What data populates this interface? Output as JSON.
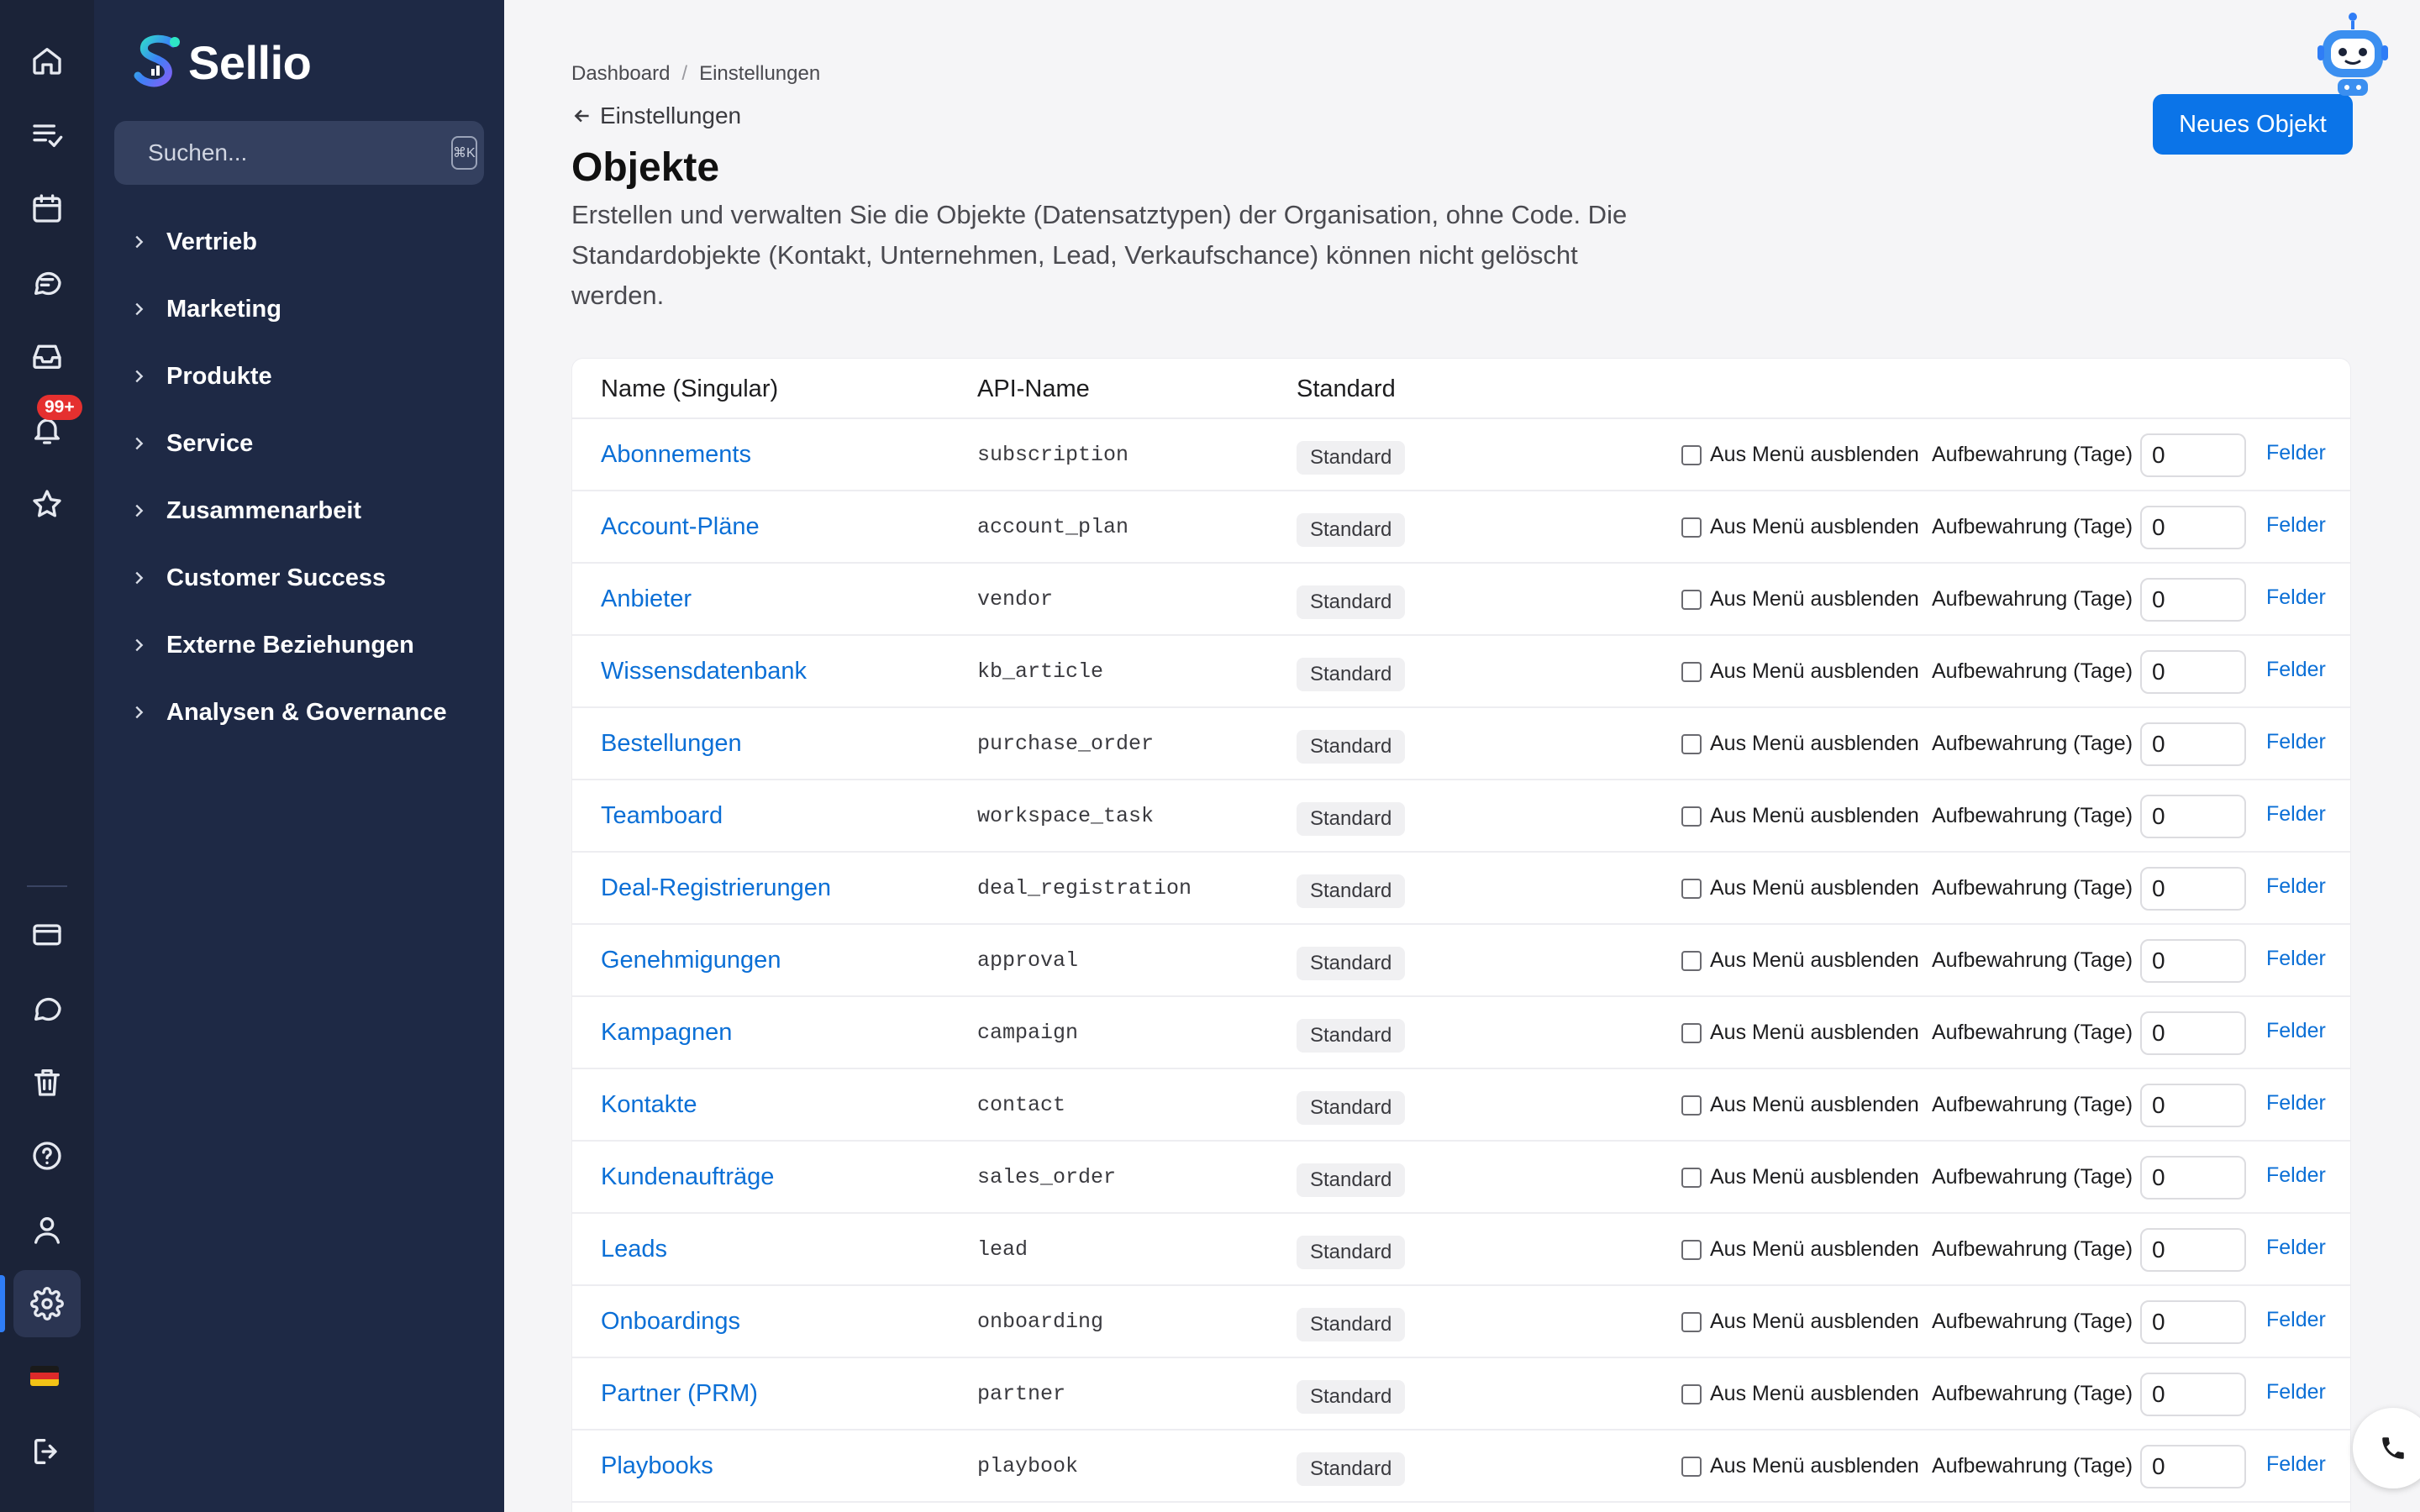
{
  "app": {
    "name": "Sellio"
  },
  "rail": {
    "items": [
      "home-icon",
      "tasks-icon",
      "calendar-icon",
      "chat-icon",
      "inbox-icon",
      "bell-icon",
      "star-icon",
      "card-icon",
      "comment-icon",
      "trash-icon",
      "help-icon",
      "user-icon",
      "gear-icon",
      "flag-de-icon",
      "logout-icon"
    ],
    "notification_badge": "99+",
    "active_color": "#2f7df6"
  },
  "sidebar": {
    "search_placeholder": "Suchen...",
    "search_shortcut": "⌘K",
    "items": [
      {
        "label": "Vertrieb"
      },
      {
        "label": "Marketing"
      },
      {
        "label": "Produkte"
      },
      {
        "label": "Service"
      },
      {
        "label": "Zusammenarbeit"
      },
      {
        "label": "Customer Success"
      },
      {
        "label": "Externe Beziehungen"
      },
      {
        "label": "Analysen & Governance"
      }
    ]
  },
  "header": {
    "breadcrumb": [
      "Dashboard",
      "Einstellungen"
    ],
    "breadcrumb_sep": "/",
    "back_label": "Einstellungen",
    "title": "Objekte",
    "description": "Erstellen und verwalten Sie die Objekte (Datensatztypen) der Organisation, ohne Code. Die Standardobjekte (Kontakt, Unternehmen, Lead, Verkaufschance) können nicht gelöscht werden.",
    "new_button": "Neues Objekt",
    "accent": "#0b74e8"
  },
  "table": {
    "columns": [
      "Name (Singular)",
      "API-Name",
      "Standard"
    ],
    "hide_label": "Aus Menü ausblenden",
    "retention_label": "Aufbewahrung (Tage)",
    "fields_label": "Felder",
    "rows": [
      {
        "name": "Abonnements",
        "api": "subscription",
        "badge": "Standard",
        "retention": "0"
      },
      {
        "name": "Account-Pläne",
        "api": "account_plan",
        "badge": "Standard",
        "retention": "0"
      },
      {
        "name": "Anbieter",
        "api": "vendor",
        "badge": "Standard",
        "retention": "0"
      },
      {
        "name": "Wissensdatenbank",
        "api": "kb_article",
        "badge": "Standard",
        "retention": "0"
      },
      {
        "name": "Bestellungen",
        "api": "purchase_order",
        "badge": "Standard",
        "retention": "0"
      },
      {
        "name": "Teamboard",
        "api": "workspace_task",
        "badge": "Standard",
        "retention": "0"
      },
      {
        "name": "Deal-Registrierungen",
        "api": "deal_registration",
        "badge": "Standard",
        "retention": "0"
      },
      {
        "name": "Genehmigungen",
        "api": "approval",
        "badge": "Standard",
        "retention": "0"
      },
      {
        "name": "Kampagnen",
        "api": "campaign",
        "badge": "Standard",
        "retention": "0"
      },
      {
        "name": "Kontakte",
        "api": "contact",
        "badge": "Standard",
        "retention": "0"
      },
      {
        "name": "Kundenaufträge",
        "api": "sales_order",
        "badge": "Standard",
        "retention": "0"
      },
      {
        "name": "Leads",
        "api": "lead",
        "badge": "Standard",
        "retention": "0"
      },
      {
        "name": "Onboardings",
        "api": "onboarding",
        "badge": "Standard",
        "retention": "0"
      },
      {
        "name": "Partner (PRM)",
        "api": "partner",
        "badge": "Standard",
        "retention": "0"
      },
      {
        "name": "Playbooks",
        "api": "playbook",
        "badge": "Standard",
        "retention": "0"
      }
    ]
  }
}
